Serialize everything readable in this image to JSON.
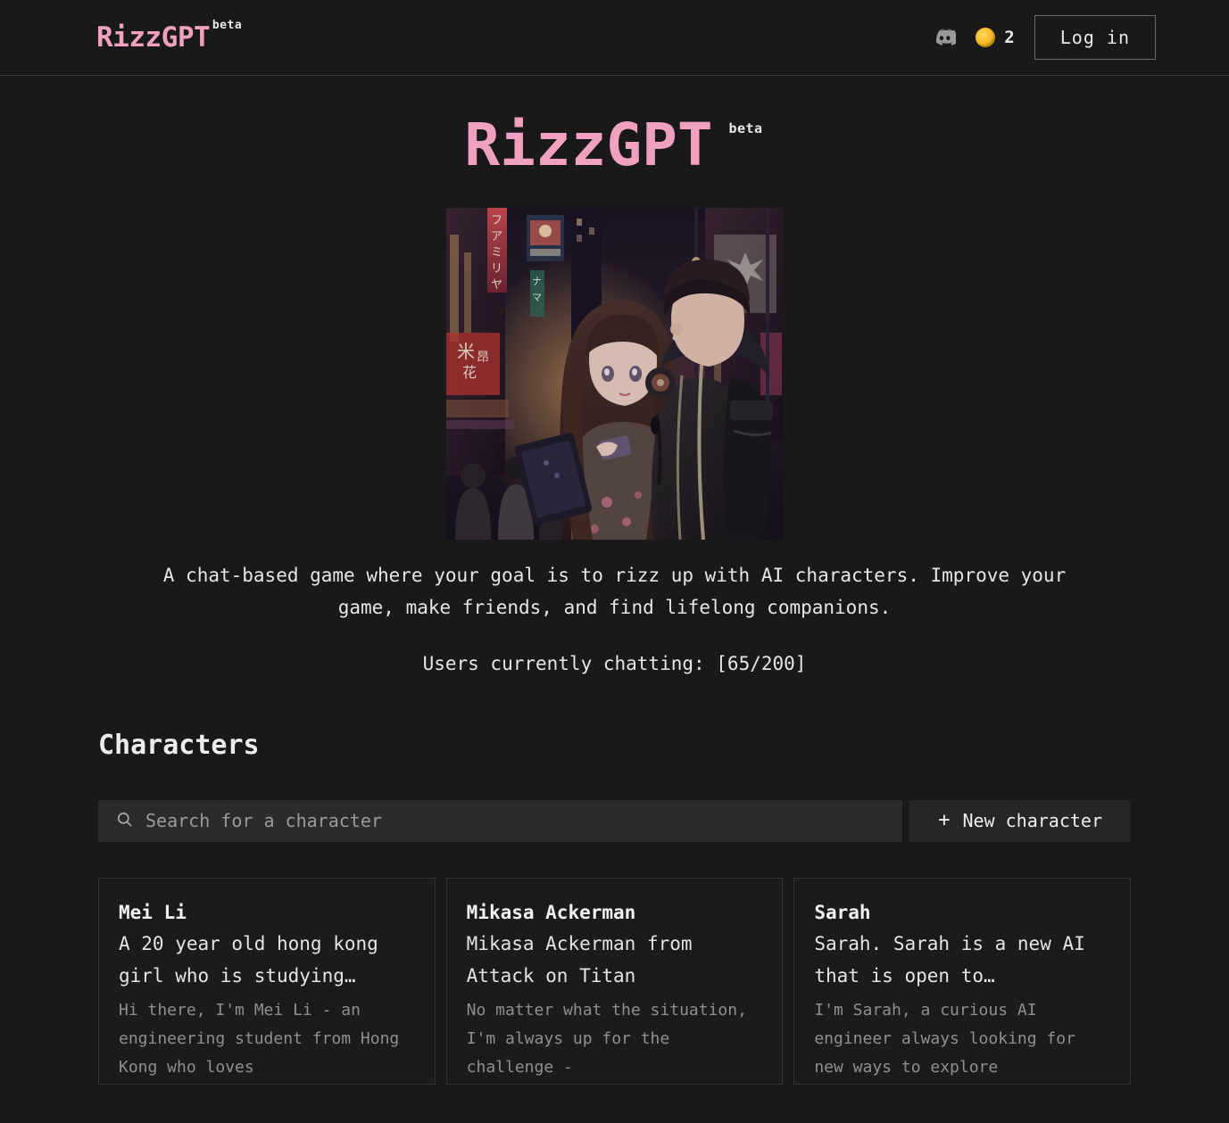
{
  "header": {
    "brand": "RizzGPT",
    "brand_badge": "beta",
    "discord_icon": "discord-icon",
    "coin_icon": "coin-icon",
    "coin_count": "2",
    "login_label": "Log in",
    "accent_color": "#f0a0c0",
    "coin_color": "#f5b316"
  },
  "hero": {
    "title": "RizzGPT",
    "badge": "beta",
    "image_alt": "anime couple on neon city street",
    "description": "A chat-based game where your goal is to rizz up with AI characters. Improve your game, make friends, and find lifelong companions.",
    "users_status": "Users currently chatting: [65/200]"
  },
  "characters_section": {
    "title": "Characters",
    "search": {
      "icon": "search-icon",
      "placeholder": "Search for a character",
      "value": ""
    },
    "new_character_button": {
      "icon": "plus-icon",
      "label": "New character"
    },
    "cards": [
      {
        "name": "Mei Li",
        "description": "A 20 year old hong kong girl who is studying…",
        "message": "Hi there, I'm Mei Li - an engineering student from Hong Kong who loves"
      },
      {
        "name": "Mikasa Ackerman",
        "description": "Mikasa Ackerman from Attack on Titan",
        "message": "No matter what the situation, I'm always up for the challenge -"
      },
      {
        "name": "Sarah",
        "description": "Sarah. Sarah is a new AI that is open to…",
        "message": "I'm Sarah, a curious AI engineer always looking for new ways to explore"
      }
    ]
  }
}
